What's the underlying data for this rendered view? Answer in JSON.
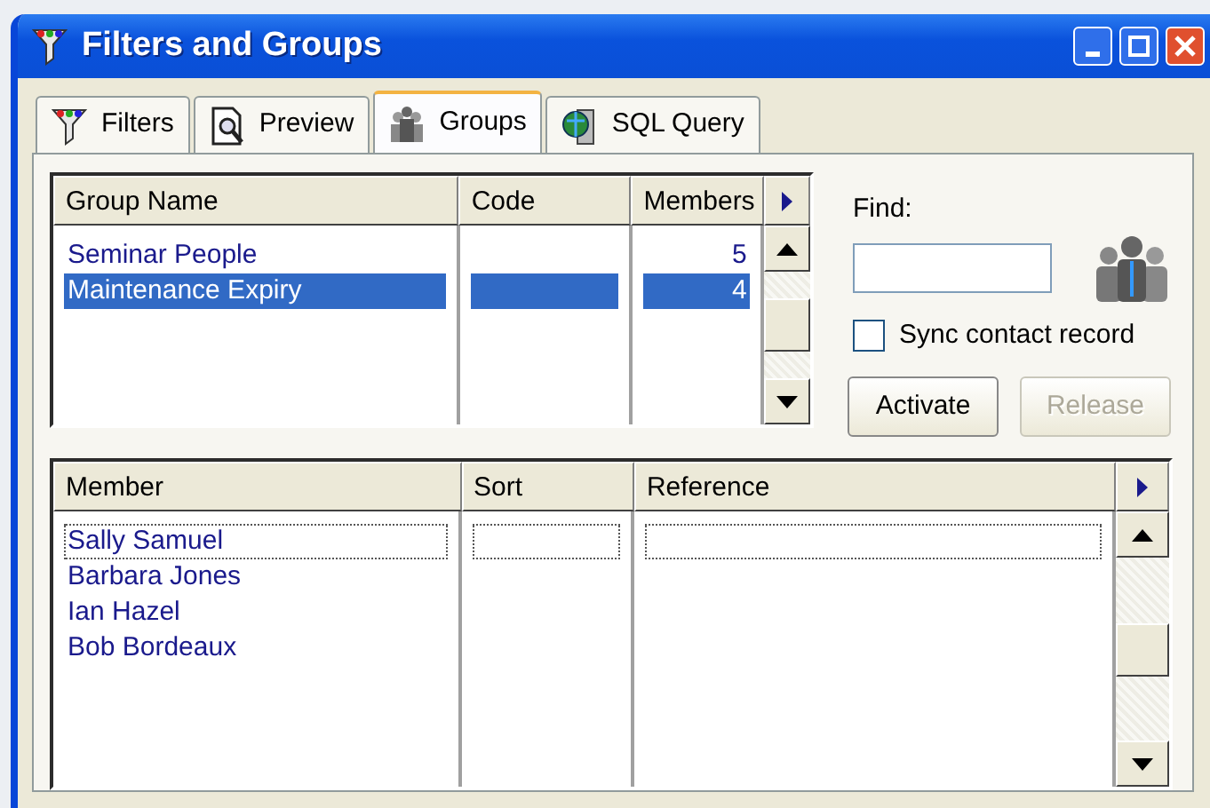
{
  "window": {
    "title": "Filters and Groups"
  },
  "tabs": [
    {
      "label": "Filters",
      "selected": false
    },
    {
      "label": "Preview",
      "selected": false
    },
    {
      "label": "Groups",
      "selected": true
    },
    {
      "label": "SQL Query",
      "selected": false
    }
  ],
  "groups_table": {
    "columns": [
      "Group Name",
      "Code",
      "Members"
    ],
    "rows": [
      {
        "group_name": "Seminar People",
        "members": "5",
        "selected": false
      },
      {
        "group_name": "Maintenance Expiry",
        "members": "4",
        "selected": true
      }
    ]
  },
  "find": {
    "label": "Find:"
  },
  "sync_contact_record": {
    "label": "Sync contact record",
    "checked": false
  },
  "buttons": [
    {
      "label": "Activate",
      "disabled": false
    },
    {
      "label": "Release",
      "disabled": true
    }
  ],
  "members_table": {
    "columns": [
      "Member",
      "Sort",
      "Reference"
    ],
    "rows": [
      {
        "member": "Sally Samuel",
        "focused": true
      },
      {
        "member": "Barbara Jones",
        "focused": false
      },
      {
        "member": "Ian Hazel",
        "focused": false
      },
      {
        "member": "Bob Bordeaux",
        "focused": false
      }
    ]
  }
}
